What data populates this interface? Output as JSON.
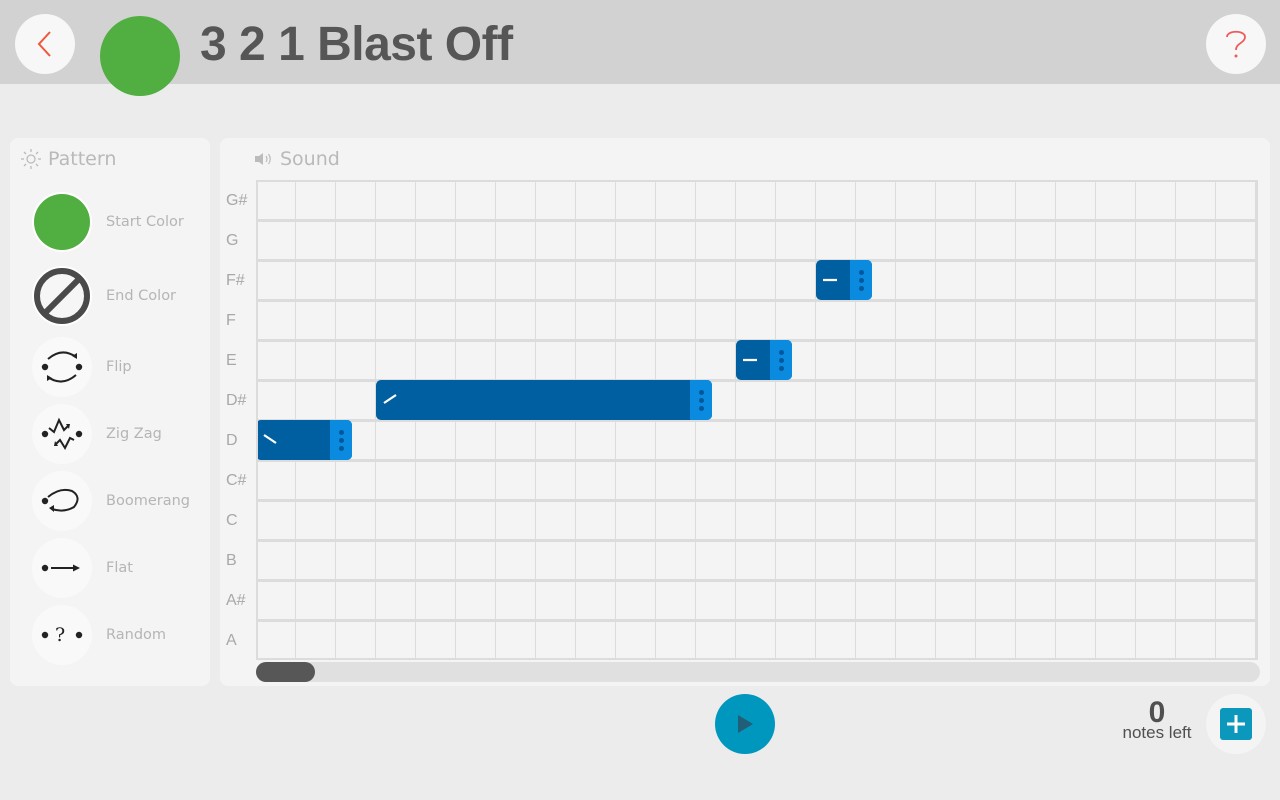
{
  "header": {
    "title": "3 2 1 Blast Off",
    "title_color": "#51ae40",
    "back_icon": "chevron-left-icon",
    "help_icon": "question-mark-icon",
    "accent_color": "#f0563a"
  },
  "pattern": {
    "heading": "Pattern",
    "heading_icon": "sun-icon",
    "items": [
      {
        "label": "Start Color",
        "icon": "color-swatch-green",
        "color": "#51ae40"
      },
      {
        "label": "End Color",
        "icon": "no-color-icon"
      },
      {
        "label": "Flip",
        "icon": "flip-icon"
      },
      {
        "label": "Zig Zag",
        "icon": "zigzag-icon"
      },
      {
        "label": "Boomerang",
        "icon": "boomerang-icon"
      },
      {
        "label": "Flat",
        "icon": "flat-arrow-icon"
      },
      {
        "label": "Random",
        "icon": "random-icon"
      }
    ]
  },
  "sound": {
    "heading": "Sound",
    "heading_icon": "speaker-icon",
    "note_labels": [
      "G#",
      "G",
      "F#",
      "F",
      "E",
      "D#",
      "D",
      "C#",
      "C",
      "B",
      "A#",
      "A"
    ],
    "columns": 25,
    "notes": [
      {
        "pitch": "D",
        "start": 0,
        "length": 2.4,
        "shape": "slope-down"
      },
      {
        "pitch": "D#",
        "start": 3,
        "length": 8.4,
        "shape": "slope-up"
      },
      {
        "pitch": "E",
        "start": 12,
        "length": 1.4,
        "shape": "flat"
      },
      {
        "pitch": "F#",
        "start": 14,
        "length": 1.4,
        "shape": "flat"
      }
    ],
    "scroll_position": 0,
    "note_color": "#005fa1",
    "handle_color": "#0a8be0"
  },
  "footer": {
    "play_icon": "play-icon",
    "play_color": "#0097be",
    "notes_left_count": "0",
    "notes_left_label": "notes left",
    "add_icon": "plus-icon",
    "add_color": "#0c98bd"
  }
}
